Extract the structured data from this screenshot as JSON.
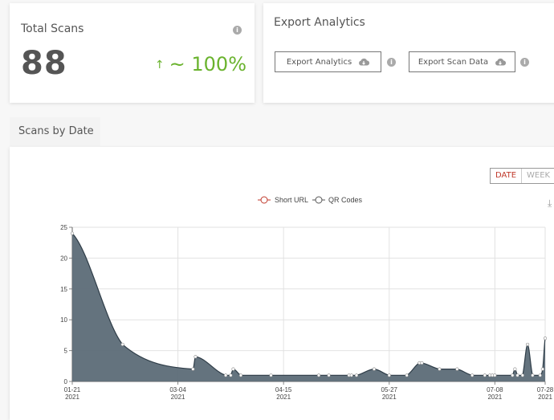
{
  "total_scans": {
    "title": "Total Scans",
    "count": "88",
    "change_arrow": "↑",
    "change": "~ 100%",
    "info_icon": "i"
  },
  "export": {
    "title": "Export Analytics",
    "buttons": [
      {
        "label": "Export Analytics",
        "icon": "cloud-download-icon"
      },
      {
        "label": "Export Scan Data",
        "icon": "cloud-download-icon"
      }
    ],
    "info_icon": "i"
  },
  "scans_by_date": {
    "tab_label": "Scans by Date",
    "toggle": {
      "date": "DATE",
      "week": "WEEK",
      "selected": "DATE"
    },
    "download_icon": "⤓"
  },
  "colors": {
    "accent_red": "#c0392b",
    "green": "#6ab32e",
    "area_fill": "#5c6b77",
    "line": "#2f3d48"
  },
  "chart_data": {
    "type": "area",
    "title": "",
    "xlabel": "",
    "ylabel": "",
    "legend": [
      {
        "name": "Short URL",
        "color": "#c0392b"
      },
      {
        "name": "QR Codes",
        "color": "#555555"
      }
    ],
    "legend_position": "top-center",
    "ylim": [
      0,
      25
    ],
    "yticks": [
      0,
      5,
      10,
      15,
      20,
      25
    ],
    "x_range_days": [
      0,
      188
    ],
    "xticks": [
      {
        "day": 0,
        "label1": "01-21",
        "label2": "2021"
      },
      {
        "day": 42,
        "label1": "03-04",
        "label2": "2021"
      },
      {
        "day": 84,
        "label1": "04-15",
        "label2": "2021"
      },
      {
        "day": 126,
        "label1": "05-27",
        "label2": "2021"
      },
      {
        "day": 168,
        "label1": "07-08",
        "label2": "2021"
      },
      {
        "day": 188,
        "label1": "07-28",
        "label2": "2021"
      }
    ],
    "grid": true,
    "series": [
      {
        "name": "QR Codes",
        "points": [
          [
            0,
            24
          ],
          [
            20,
            6
          ],
          [
            48,
            2
          ],
          [
            49,
            4
          ],
          [
            61,
            1
          ],
          [
            63,
            1
          ],
          [
            64,
            2
          ],
          [
            67,
            1
          ],
          [
            79,
            1
          ],
          [
            98,
            1
          ],
          [
            102,
            1
          ],
          [
            110,
            1
          ],
          [
            111,
            1
          ],
          [
            113,
            1
          ],
          [
            120,
            2
          ],
          [
            126,
            1
          ],
          [
            133,
            1
          ],
          [
            138,
            3
          ],
          [
            139,
            3
          ],
          [
            146,
            2
          ],
          [
            153,
            2
          ],
          [
            159,
            1
          ],
          [
            164,
            1
          ],
          [
            166,
            1
          ],
          [
            167,
            1
          ],
          [
            168,
            1
          ],
          [
            175,
            1
          ],
          [
            176,
            2
          ],
          [
            177,
            1
          ],
          [
            179,
            1
          ],
          [
            181,
            6
          ],
          [
            183,
            1
          ],
          [
            186,
            1
          ],
          [
            187,
            2
          ],
          [
            188,
            7
          ]
        ]
      }
    ]
  }
}
